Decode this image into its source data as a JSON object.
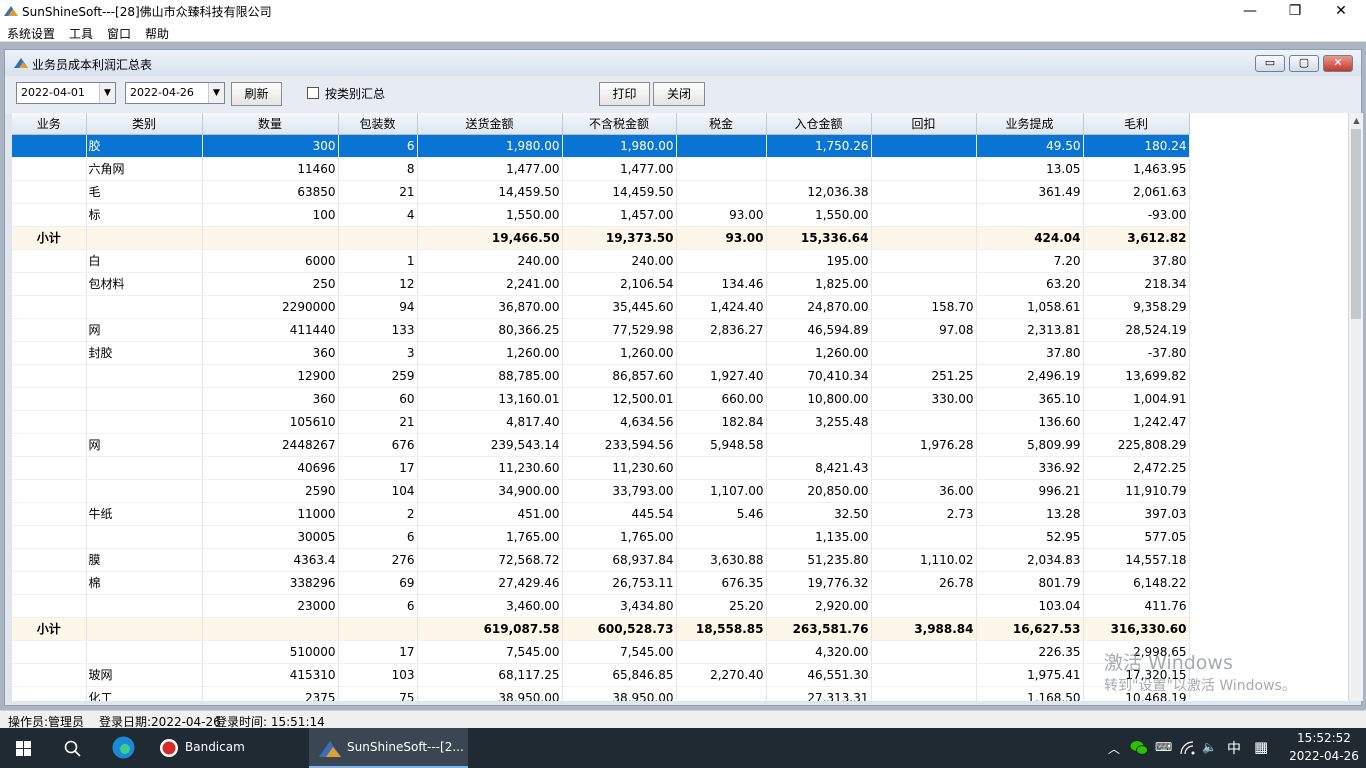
{
  "window": {
    "title": "SunShineSoft---[28]佛山市众臻科技有限公司",
    "minimize_glyph": "—",
    "restore_glyph": "❐",
    "close_glyph": "✕"
  },
  "menu": [
    "系统设置",
    "工具",
    "窗口",
    "帮助"
  ],
  "child": {
    "title": "业务员成本利润汇总表",
    "min_glyph": "▭",
    "max_glyph": "▢",
    "close_glyph": "✕"
  },
  "toolbar": {
    "date_from": "2022-04-01",
    "date_to": "2022-04-26",
    "refresh_label": "刷新",
    "group_by_category_label": "按类别汇总",
    "group_by_category_checked": false,
    "print_label": "打印",
    "close_label": "关闭"
  },
  "grid": {
    "columns": [
      "业务",
      "类别",
      "数量",
      "包装数",
      "送货金额",
      "不含税金额",
      "税金",
      "入仓金额",
      "回扣",
      "业务提成",
      "毛利"
    ],
    "rows": [
      {
        "type": "sel",
        "cells": [
          "",
          "胶",
          "300",
          "6",
          "1,980.00",
          "1,980.00",
          "",
          "1,750.26",
          "",
          "49.50",
          "180.24"
        ]
      },
      {
        "type": "row",
        "cells": [
          "",
          "六角网",
          "11460",
          "8",
          "1,477.00",
          "1,477.00",
          "",
          "",
          "",
          "13.05",
          "1,463.95"
        ]
      },
      {
        "type": "row",
        "cells": [
          "",
          "毛",
          "63850",
          "21",
          "14,459.50",
          "14,459.50",
          "",
          "12,036.38",
          "",
          "361.49",
          "2,061.63"
        ]
      },
      {
        "type": "row",
        "cells": [
          "",
          "标",
          "100",
          "4",
          "1,550.00",
          "1,457.00",
          "93.00",
          "1,550.00",
          "",
          "",
          "-93.00"
        ]
      },
      {
        "type": "sub",
        "cells": [
          "小计",
          "",
          "",
          "",
          "19,466.50",
          "19,373.50",
          "93.00",
          "15,336.64",
          "",
          "424.04",
          "3,612.82"
        ]
      },
      {
        "type": "row",
        "cells": [
          "",
          "白",
          "6000",
          "1",
          "240.00",
          "240.00",
          "",
          "195.00",
          "",
          "7.20",
          "37.80"
        ]
      },
      {
        "type": "row",
        "cells": [
          "",
          "包材料",
          "250",
          "12",
          "2,241.00",
          "2,106.54",
          "134.46",
          "1,825.00",
          "",
          "63.20",
          "218.34"
        ]
      },
      {
        "type": "row",
        "cells": [
          "",
          "",
          "2290000",
          "94",
          "36,870.00",
          "35,445.60",
          "1,424.40",
          "24,870.00",
          "158.70",
          "1,058.61",
          "9,358.29"
        ]
      },
      {
        "type": "row",
        "cells": [
          "",
          "网",
          "411440",
          "133",
          "80,366.25",
          "77,529.98",
          "2,836.27",
          "46,594.89",
          "97.08",
          "2,313.81",
          "28,524.19"
        ]
      },
      {
        "type": "row",
        "cells": [
          "",
          "封胶",
          "360",
          "3",
          "1,260.00",
          "1,260.00",
          "",
          "1,260.00",
          "",
          "37.80",
          "-37.80"
        ]
      },
      {
        "type": "row",
        "cells": [
          "",
          "",
          "12900",
          "259",
          "88,785.00",
          "86,857.60",
          "1,927.40",
          "70,410.34",
          "251.25",
          "2,496.19",
          "13,699.82"
        ]
      },
      {
        "type": "row",
        "cells": [
          "",
          "",
          "360",
          "60",
          "13,160.01",
          "12,500.01",
          "660.00",
          "10,800.00",
          "330.00",
          "365.10",
          "1,004.91"
        ]
      },
      {
        "type": "row",
        "cells": [
          "",
          "",
          "105610",
          "21",
          "4,817.40",
          "4,634.56",
          "182.84",
          "3,255.48",
          "",
          "136.60",
          "1,242.47"
        ]
      },
      {
        "type": "row",
        "cells": [
          "",
          "网",
          "2448267",
          "676",
          "239,543.14",
          "233,594.56",
          "5,948.58",
          "",
          "1,976.28",
          "5,809.99",
          "225,808.29"
        ]
      },
      {
        "type": "row",
        "cells": [
          "",
          "",
          "40696",
          "17",
          "11,230.60",
          "11,230.60",
          "",
          "8,421.43",
          "",
          "336.92",
          "2,472.25"
        ]
      },
      {
        "type": "row",
        "cells": [
          "",
          "",
          "2590",
          "104",
          "34,900.00",
          "33,793.00",
          "1,107.00",
          "20,850.00",
          "36.00",
          "996.21",
          "11,910.79"
        ]
      },
      {
        "type": "row",
        "cells": [
          "",
          "牛纸",
          "11000",
          "2",
          "451.00",
          "445.54",
          "5.46",
          "32.50",
          "2.73",
          "13.28",
          "397.03"
        ]
      },
      {
        "type": "row",
        "cells": [
          "",
          "",
          "30005",
          "6",
          "1,765.00",
          "1,765.00",
          "",
          "1,135.00",
          "",
          "52.95",
          "577.05"
        ]
      },
      {
        "type": "row",
        "cells": [
          "",
          "膜",
          "4363.4",
          "276",
          "72,568.72",
          "68,937.84",
          "3,630.88",
          "51,235.80",
          "1,110.02",
          "2,034.83",
          "14,557.18"
        ]
      },
      {
        "type": "row",
        "cells": [
          "",
          "棉",
          "338296",
          "69",
          "27,429.46",
          "26,753.11",
          "676.35",
          "19,776.32",
          "26.78",
          "801.79",
          "6,148.22"
        ]
      },
      {
        "type": "row",
        "cells": [
          "",
          "",
          "23000",
          "6",
          "3,460.00",
          "3,434.80",
          "25.20",
          "2,920.00",
          "",
          "103.04",
          "411.76"
        ]
      },
      {
        "type": "sub",
        "cells": [
          "小计",
          "",
          "",
          "",
          "619,087.58",
          "600,528.73",
          "18,558.85",
          "263,581.76",
          "3,988.84",
          "16,627.53",
          "316,330.60"
        ]
      },
      {
        "type": "row",
        "cells": [
          "",
          "",
          "510000",
          "17",
          "7,545.00",
          "7,545.00",
          "",
          "4,320.00",
          "",
          "226.35",
          "2,998.65"
        ]
      },
      {
        "type": "row",
        "cells": [
          "",
          "玻网",
          "415310",
          "103",
          "68,117.25",
          "65,846.85",
          "2,270.40",
          "46,551.30",
          "",
          "1,975.41",
          "17,320.15"
        ]
      },
      {
        "type": "row",
        "cells": [
          "",
          "化工",
          "2375",
          "75",
          "38,950.00",
          "38,950.00",
          "",
          "27,313.31",
          "",
          "1,168.50",
          "10,468.19"
        ]
      }
    ]
  },
  "watermark": {
    "line1": "激活 Windows",
    "line2": "转到\"设置\"以激活 Windows。"
  },
  "status": {
    "operator": "操作员:管理员",
    "login_date": "登录日期:2022-04-26",
    "login_time": "登录时间: 15:51:14"
  },
  "taskbar": {
    "bandicam_label": "Bandicam",
    "app_label": "SunShineSoft---[2...",
    "ime_label": "中",
    "clock_time": "15:52:52",
    "clock_date": "2022-04-26"
  },
  "colors": {
    "selection": "#0a74d4",
    "subtotal_row": "#fdf7e9",
    "mdi_background": "#aab4c2",
    "taskbar": "#1f2a33"
  }
}
